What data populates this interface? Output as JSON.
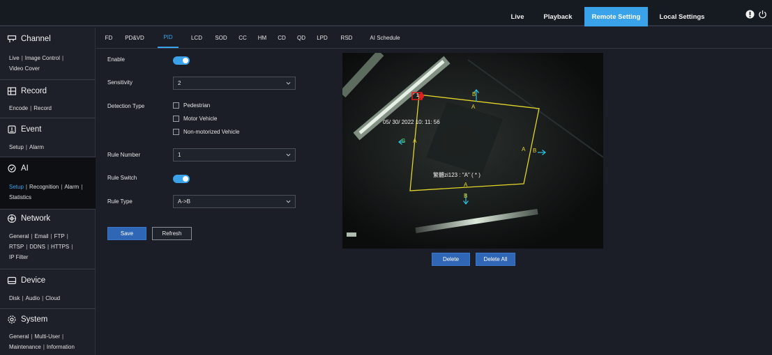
{
  "topbar": {
    "nav": [
      {
        "label": "Live",
        "active": false
      },
      {
        "label": "Playback",
        "active": false
      },
      {
        "label": "Remote Setting",
        "active": true
      },
      {
        "label": "Local Settings",
        "active": false
      }
    ],
    "accent": "#3aa2e8"
  },
  "sidebar": {
    "sections": [
      {
        "title": "Channel",
        "icon": "channel-icon",
        "rows": [
          [
            "Live",
            "Image Control"
          ],
          [
            "Video Cover"
          ]
        ],
        "active": false
      },
      {
        "title": "Record",
        "icon": "record-icon",
        "rows": [
          [
            "Encode",
            "Record"
          ]
        ],
        "active": false
      },
      {
        "title": "Event",
        "icon": "event-icon",
        "rows": [
          [
            "Setup",
            "Alarm"
          ]
        ],
        "active": false
      },
      {
        "title": "AI",
        "icon": "ai-icon",
        "rows": [
          [
            "Setup",
            "Recognition",
            "Alarm"
          ],
          [
            "Statistics"
          ]
        ],
        "active": true,
        "active_link": "Setup"
      },
      {
        "title": "Network",
        "icon": "network-icon",
        "rows": [
          [
            "General",
            "Email",
            "FTP"
          ],
          [
            "RTSP",
            "DDNS",
            "HTTPS"
          ],
          [
            "IP Filter"
          ]
        ],
        "active": false
      },
      {
        "title": "Device",
        "icon": "device-icon",
        "rows": [
          [
            "Disk",
            "Audio",
            "Cloud"
          ]
        ],
        "active": false
      },
      {
        "title": "System",
        "icon": "system-icon",
        "rows": [
          [
            "General",
            "Multi-User"
          ],
          [
            "Maintenance",
            "Information"
          ]
        ],
        "active": false
      }
    ]
  },
  "tabs": [
    {
      "label": "FD",
      "active": false
    },
    {
      "label": "PD&VD",
      "active": false
    },
    {
      "label": "PID",
      "active": true
    },
    {
      "label": "LCD",
      "active": false
    },
    {
      "label": "SOD",
      "active": false
    },
    {
      "label": "CC",
      "active": false
    },
    {
      "label": "HM",
      "active": false
    },
    {
      "label": "CD",
      "active": false
    },
    {
      "label": "QD",
      "active": false
    },
    {
      "label": "LPD",
      "active": false
    },
    {
      "label": "RSD",
      "active": false
    },
    {
      "label": "AI Schedule",
      "active": false
    }
  ],
  "form": {
    "enable_label": "Enable",
    "enable_on": true,
    "sensitivity_label": "Sensitivity",
    "sensitivity_value": "2",
    "detection_type_label": "Detection Type",
    "detection_options": [
      {
        "label": "Pedestrian",
        "checked": false
      },
      {
        "label": "Motor Vehicle",
        "checked": false
      },
      {
        "label": "Non-motorized Vehicle",
        "checked": false
      }
    ],
    "rule_number_label": "Rule Number",
    "rule_number_value": "1",
    "rule_switch_label": "Rule Switch",
    "rule_switch_on": true,
    "rule_type_label": "Rule Type",
    "rule_type_value": "A->B"
  },
  "buttons": {
    "save": "Save",
    "refresh": "Refresh",
    "delete": "Delete",
    "delete_all": "Delete All"
  },
  "video": {
    "timestamp": "05/ 30/ 2022  10: 11: 56",
    "rule_caption": "繁體zi123 : \"A\" ( * )",
    "marker_number": "1",
    "side_a": "A",
    "side_b": "B",
    "zone_color": "#e3d52a",
    "arrow_color": "#2ec4e0",
    "marker_color": "#e02020"
  }
}
